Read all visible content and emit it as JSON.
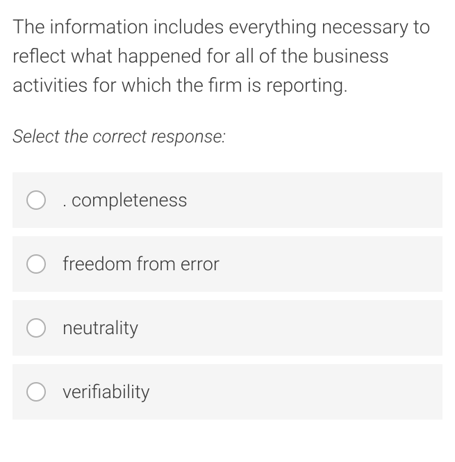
{
  "question": "The information includes everything necessary to reflect what happened for all of the business activities for which the firm is reporting.",
  "instruction": "Select the correct response:",
  "options": [
    {
      "label": ". completeness"
    },
    {
      "label": "freedom from error"
    },
    {
      "label": "neutrality"
    },
    {
      "label": "verifiability"
    }
  ]
}
